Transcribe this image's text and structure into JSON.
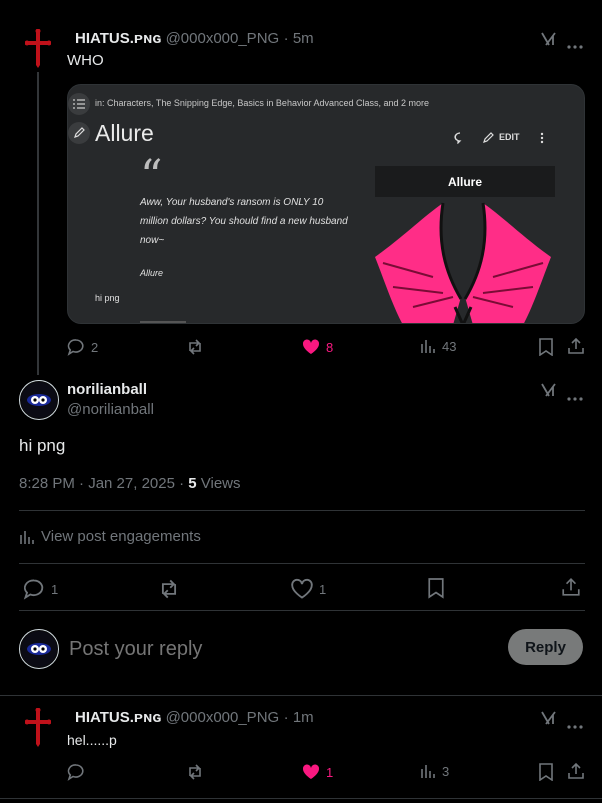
{
  "colors": {
    "background": "#000000",
    "text": "#e7e9ea",
    "muted": "#71767b",
    "like": "#f91880",
    "divider": "#2f3336"
  },
  "tweet1": {
    "name": "HIATUS.ᴘɴɢ",
    "handle": "@000x000_PNG",
    "time": "· 5m",
    "text": "WHO",
    "embed": {
      "categories": "in: Characters, The Snipping Edge, Basics in Behavior Advanced Class, and 2 more",
      "title": "Allure",
      "edit_label": "EDIT",
      "quote": "Aww, Your husband's ransom is ONLY 10 million dollars? You should find a new husband now~",
      "quote_author": "Allure",
      "infobox_title": "Allure",
      "footer_text": "hi png"
    },
    "replies": "2",
    "retweets": "",
    "likes": "8",
    "views": "43"
  },
  "main": {
    "name": "norilianball",
    "handle": "@norilianball",
    "text": "hi png",
    "timestamp": "8:28 PM · Jan 27, 2025 · ",
    "views_count": "5",
    "views_label": " Views",
    "engagements_label": "View post engagements",
    "replies": "1",
    "likes": "1"
  },
  "composer": {
    "placeholder": "Post your reply",
    "reply_button": "Reply"
  },
  "tweet2": {
    "name": "HIATUS.ᴘɴɢ",
    "handle": "@000x000_PNG",
    "time": "· 1m",
    "text": "hel......p",
    "likes": "1",
    "views": "3"
  }
}
